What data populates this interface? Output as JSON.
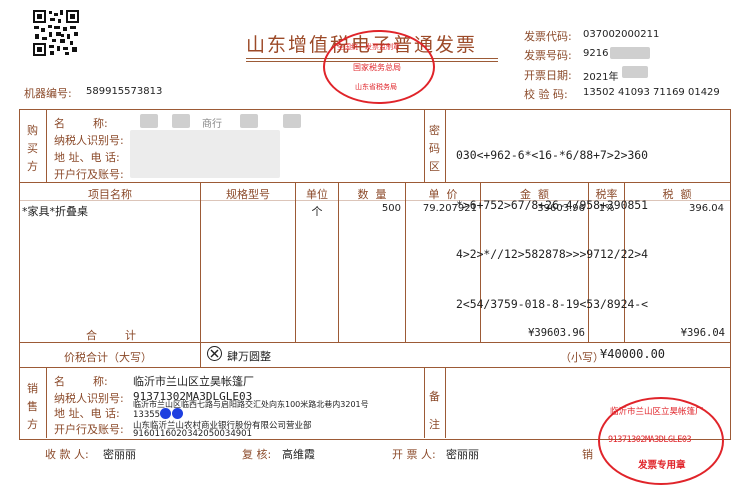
{
  "header": {
    "title": "山东增值税电子普通发票",
    "machine_label": "机器编号:",
    "machine_no": "589915573813",
    "invoice_code_label": "发票代码:",
    "invoice_code": "037002000211",
    "invoice_no_label": "发票号码:",
    "invoice_no": "9216",
    "issue_date_label": "开票日期:",
    "issue_date": "2021年",
    "check_code_label": "校 验 码:",
    "check_code": "13502 41093 71169 01429"
  },
  "tax_stamp": {
    "top": "全国统一发票监制章",
    "middle": "国家税务总局",
    "bottom": "山东省税务局"
  },
  "buyer": {
    "side_label": [
      "购",
      "买",
      "方"
    ],
    "name_label": "名        称:",
    "taxid_label": "纳税人识别号:",
    "address_label": "地 址、电 话:",
    "bank_label": "开户行及账号:",
    "partial_name": "商行"
  },
  "cipher": {
    "side_label": [
      "密",
      "码",
      "区"
    ],
    "lines": [
      "030<+962-6*<16-*6/88+7>2>360",
      "*>6+752>67/8+26-4/958+390851",
      "4>2>*//12>582878>>>9712/22>4",
      "2<54/3759-018-8-19<53/8924-<"
    ]
  },
  "items": {
    "headers": [
      "项目名称",
      "规格型号",
      "单位",
      "数  量",
      "单  价",
      "金  额",
      "税率",
      "税  额"
    ],
    "rows": [
      {
        "name": "*家具*折叠桌",
        "spec": "",
        "unit": "个",
        "qty": "500",
        "price": "79.207921",
        "amount": "39603.96",
        "rate": "1%",
        "tax": "396.04"
      }
    ],
    "subtotal_label": "合        计",
    "subtotal_amount": "¥39603.96",
    "subtotal_tax": "¥396.04"
  },
  "total": {
    "label": "价税合计（大写）",
    "words": "肆万圆整",
    "small_label": "（小写）",
    "amount": "¥40000.00"
  },
  "seller": {
    "side_label": [
      "销",
      "售",
      "方"
    ],
    "name_label": "名        称:",
    "name": "临沂市兰山区立昊帐篷厂",
    "taxid_label": "纳税人识别号:",
    "taxid": "91371302MA3DLGLE03",
    "address_label": "地 址、电 话:",
    "address": "临沂市兰山区临西七路与启阳路交汇处向东100米路北巷内3201号",
    "phone": "13355",
    "bank_label": "开户行及账号:",
    "bank": "山东临沂兰山农村商业银行股份有限公司营业部",
    "account": "9160116020342050034901",
    "notes_label": [
      "备",
      "注"
    ]
  },
  "footer": {
    "payee_label": "收 款 人:",
    "payee": "密丽丽",
    "reviewer_label": "复 核:",
    "reviewer": "高维霞",
    "drawer_label": "开 票 人:",
    "drawer": "密丽丽",
    "seller_label": "销"
  },
  "seller_stamp": {
    "arc": "临沂市兰山区立昊帐篷厂",
    "taxid": "91371302MA3DLGLE03",
    "bottom": "发票专用章"
  },
  "colors": {
    "frame": "#9c5a36",
    "stamp": "#e0242a",
    "text": "#222222"
  }
}
